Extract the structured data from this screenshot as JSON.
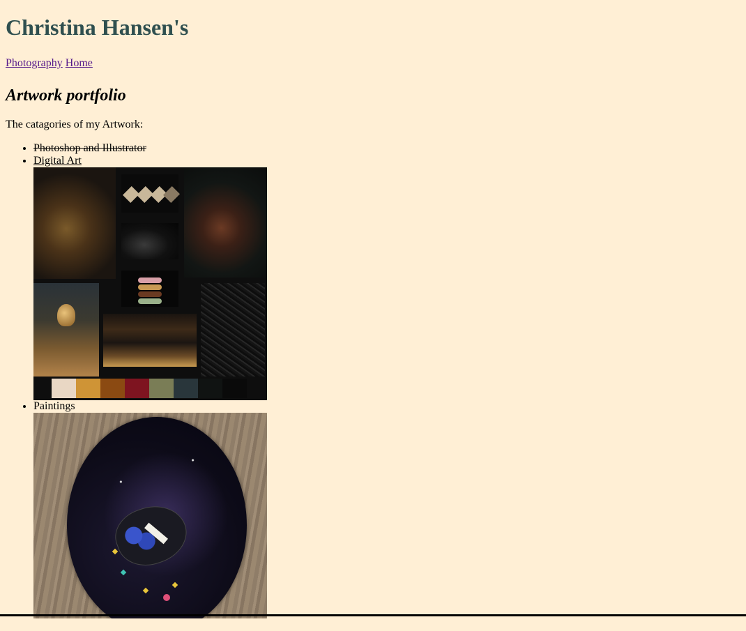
{
  "header": {
    "title": "Christina Hansen's"
  },
  "nav": {
    "links": [
      {
        "label": "Photography"
      },
      {
        "label": "Home"
      }
    ]
  },
  "main": {
    "section_title": "Artwork portfolio",
    "intro": "The catagories of my Artwork:",
    "categories": [
      {
        "label": "Photoshop and Illustrator",
        "style": "strikethrough"
      },
      {
        "label": "Digital Art",
        "style": "underline"
      },
      {
        "label": "Paintings",
        "style": "plain"
      }
    ],
    "palette_colors": [
      "#e9d7c4",
      "#cf9436",
      "#8b4a12",
      "#7e1420",
      "#7a7d56",
      "#29363b",
      "#101312",
      "#0a0a0a"
    ]
  },
  "theme": {
    "background": "#ffefd5",
    "title_color": "#2f4f4f",
    "link_color": "#551a8b"
  }
}
